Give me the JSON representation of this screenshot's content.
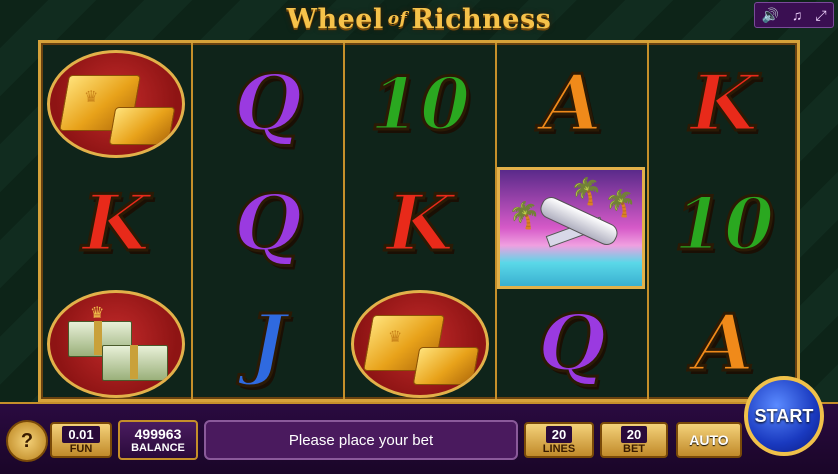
{
  "header": {
    "title_part1": "Wheel",
    "title_part2": "of",
    "title_part3": "Richness",
    "controls": [
      {
        "icon": "speaker-icon",
        "glyph": "🔊"
      },
      {
        "icon": "music-note-icon",
        "glyph": "♫"
      },
      {
        "icon": "fullscreen-icon",
        "glyph": "⤢"
      }
    ]
  },
  "reels": [
    [
      {
        "symbol": "gold-bars"
      },
      {
        "symbol": "K"
      },
      {
        "symbol": "cash-stacks"
      }
    ],
    [
      {
        "symbol": "Q"
      },
      {
        "symbol": "Q"
      },
      {
        "symbol": "J"
      }
    ],
    [
      {
        "symbol": "10"
      },
      {
        "symbol": "K"
      },
      {
        "symbol": "gold-bars"
      }
    ],
    [
      {
        "symbol": "A"
      },
      {
        "symbol": "private-jet"
      },
      {
        "symbol": "Q"
      }
    ],
    [
      {
        "symbol": "K"
      },
      {
        "symbol": "10"
      },
      {
        "symbol": "A"
      }
    ]
  ],
  "bottom_bar": {
    "help_label": "?",
    "coin_value": "0.01",
    "coin_label": "FUN",
    "balance_value": "499963",
    "balance_label": "BALANCE",
    "message": "Please place your bet",
    "lines_value": "20",
    "lines_label": "LINES",
    "bet_value": "20",
    "bet_label": "BET",
    "auto_label": "AUTO",
    "start_label": "START"
  },
  "colors": {
    "accent_gold": "#d6a23a",
    "panel_purple": "#2a0a40",
    "start_blue": "#1a3ac0"
  }
}
